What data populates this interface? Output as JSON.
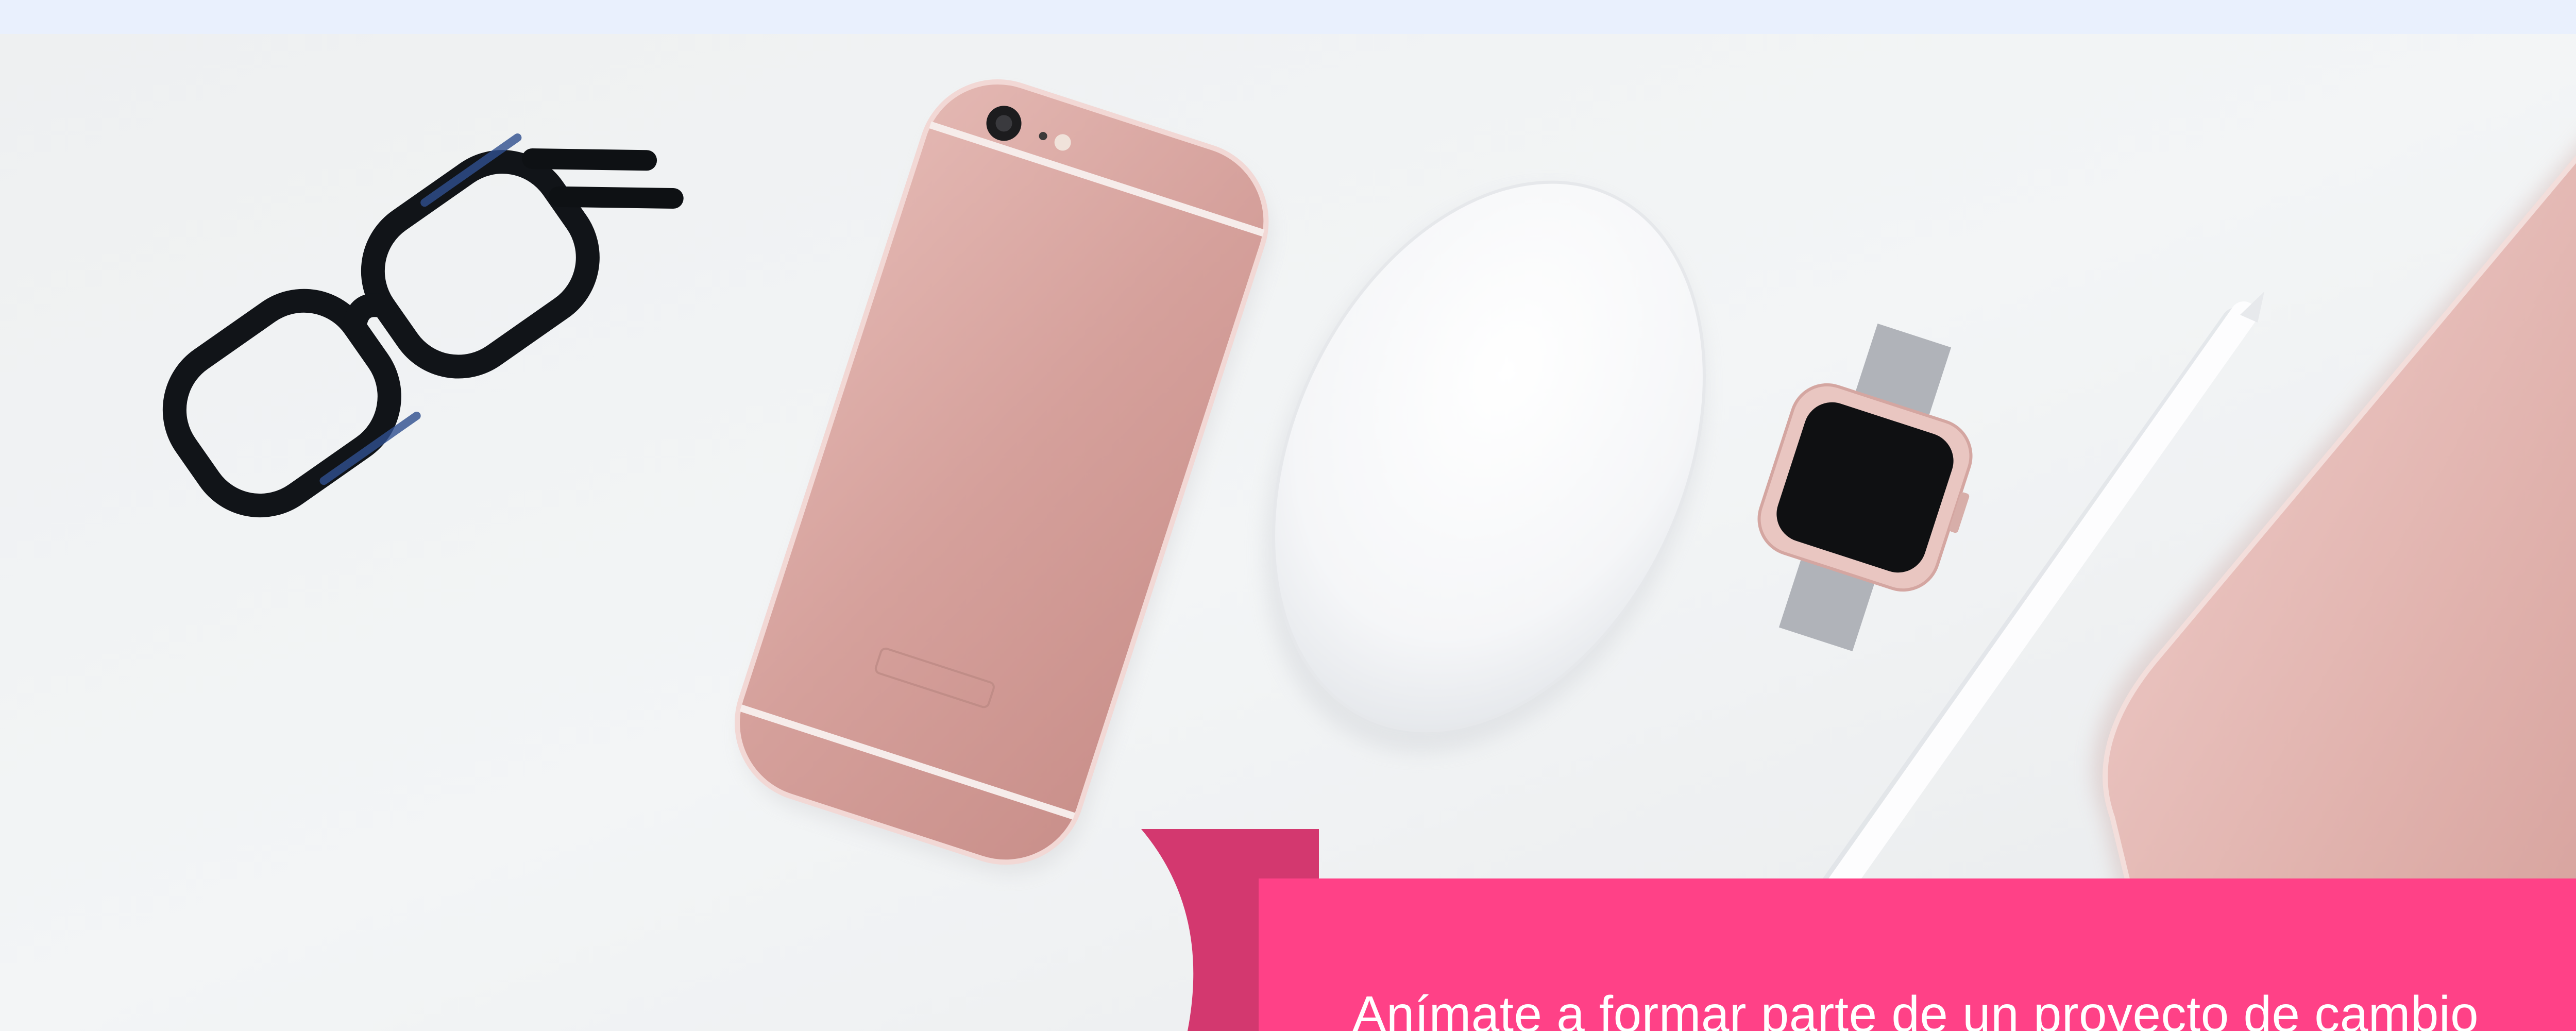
{
  "banner": {
    "text": "Anímate a formar parte de un proyecto de cambio"
  },
  "hero": {
    "objects": [
      "eyeglasses-icon",
      "phone-icon",
      "mouse-icon",
      "smartwatch-icon",
      "stylus-icon",
      "tablet-icon"
    ]
  },
  "colors": {
    "page_background": "#e9f0fd",
    "desk_surface": "#f2f4f5",
    "rose_gold": "#d9a4a0",
    "banner_pink": "#ff4187",
    "ribbon_fold": "#d3386f"
  }
}
